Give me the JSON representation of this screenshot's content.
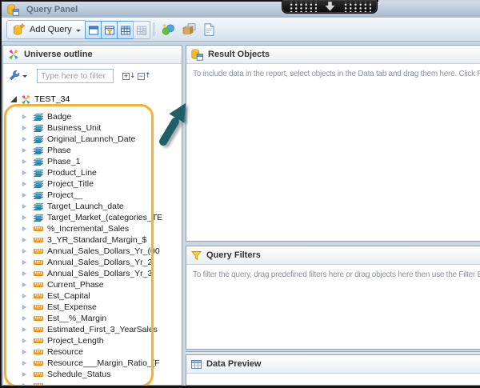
{
  "window": {
    "title": "Query Panel"
  },
  "toolbar": {
    "add_query": "Add Query",
    "icons": [
      "result-pane-toggle",
      "filter-pane-toggle",
      "data-preview-pane-toggle",
      "freeze-pane-toggle",
      "combined-query",
      "query-properties",
      "view-script"
    ]
  },
  "universe_panel": {
    "title": "Universe outline",
    "filter_placeholder": "Type here to filter",
    "root_label": "TEST_34",
    "items": [
      {
        "label": "Badge",
        "type": "dim"
      },
      {
        "label": "Business_Unit",
        "type": "dim"
      },
      {
        "label": "Original_Launnch_Date",
        "type": "dim"
      },
      {
        "label": "Phase",
        "type": "dim"
      },
      {
        "label": "Phase_1",
        "type": "dim"
      },
      {
        "label": "Product_Line",
        "type": "dim"
      },
      {
        "label": "Project_Title",
        "type": "dim"
      },
      {
        "label": "Project__",
        "type": "dim"
      },
      {
        "label": "Target_Launch_date",
        "type": "dim"
      },
      {
        "label": "Target_Market_(categories_TE",
        "type": "dim"
      },
      {
        "label": "%_Incremental_Sales",
        "type": "measure"
      },
      {
        "label": "3_YR_Standard_Margin_$",
        "type": "measure"
      },
      {
        "label": "Annual_Sales_Dollars_Yr_(00",
        "type": "measure"
      },
      {
        "label": "Annual_Sales_Dollars_Yr_2",
        "type": "measure"
      },
      {
        "label": "Annual_Sales_Dollars_Yr_3",
        "type": "measure"
      },
      {
        "label": "Current_Phase",
        "type": "measure"
      },
      {
        "label": "Est_Capital",
        "type": "measure"
      },
      {
        "label": "Est_Expense",
        "type": "measure"
      },
      {
        "label": "Est__%_Margin",
        "type": "measure"
      },
      {
        "label": "Estimated_First_3_YearSales",
        "type": "measure"
      },
      {
        "label": "Project_Length",
        "type": "measure"
      },
      {
        "label": "Resource",
        "type": "measure"
      },
      {
        "label": "Resource___Margin_Ratio_(F",
        "type": "measure"
      },
      {
        "label": "Schedule_Status",
        "type": "measure"
      },
      {
        "label": "",
        "type": "measure"
      }
    ]
  },
  "result_objects": {
    "title": "Result Objects",
    "hint": "To include data in the report, select objects in the Data tab and drag them here. Click Run Qu"
  },
  "query_filters": {
    "title": "Query Filters",
    "hint": "To filter the query, drag predefined filters here or drag objects here then use the Filter Edito"
  },
  "data_preview": {
    "title": "Data Preview"
  },
  "annotations": {
    "highlight_color": "#f2b237",
    "arrow_color": "#1c5f66"
  }
}
